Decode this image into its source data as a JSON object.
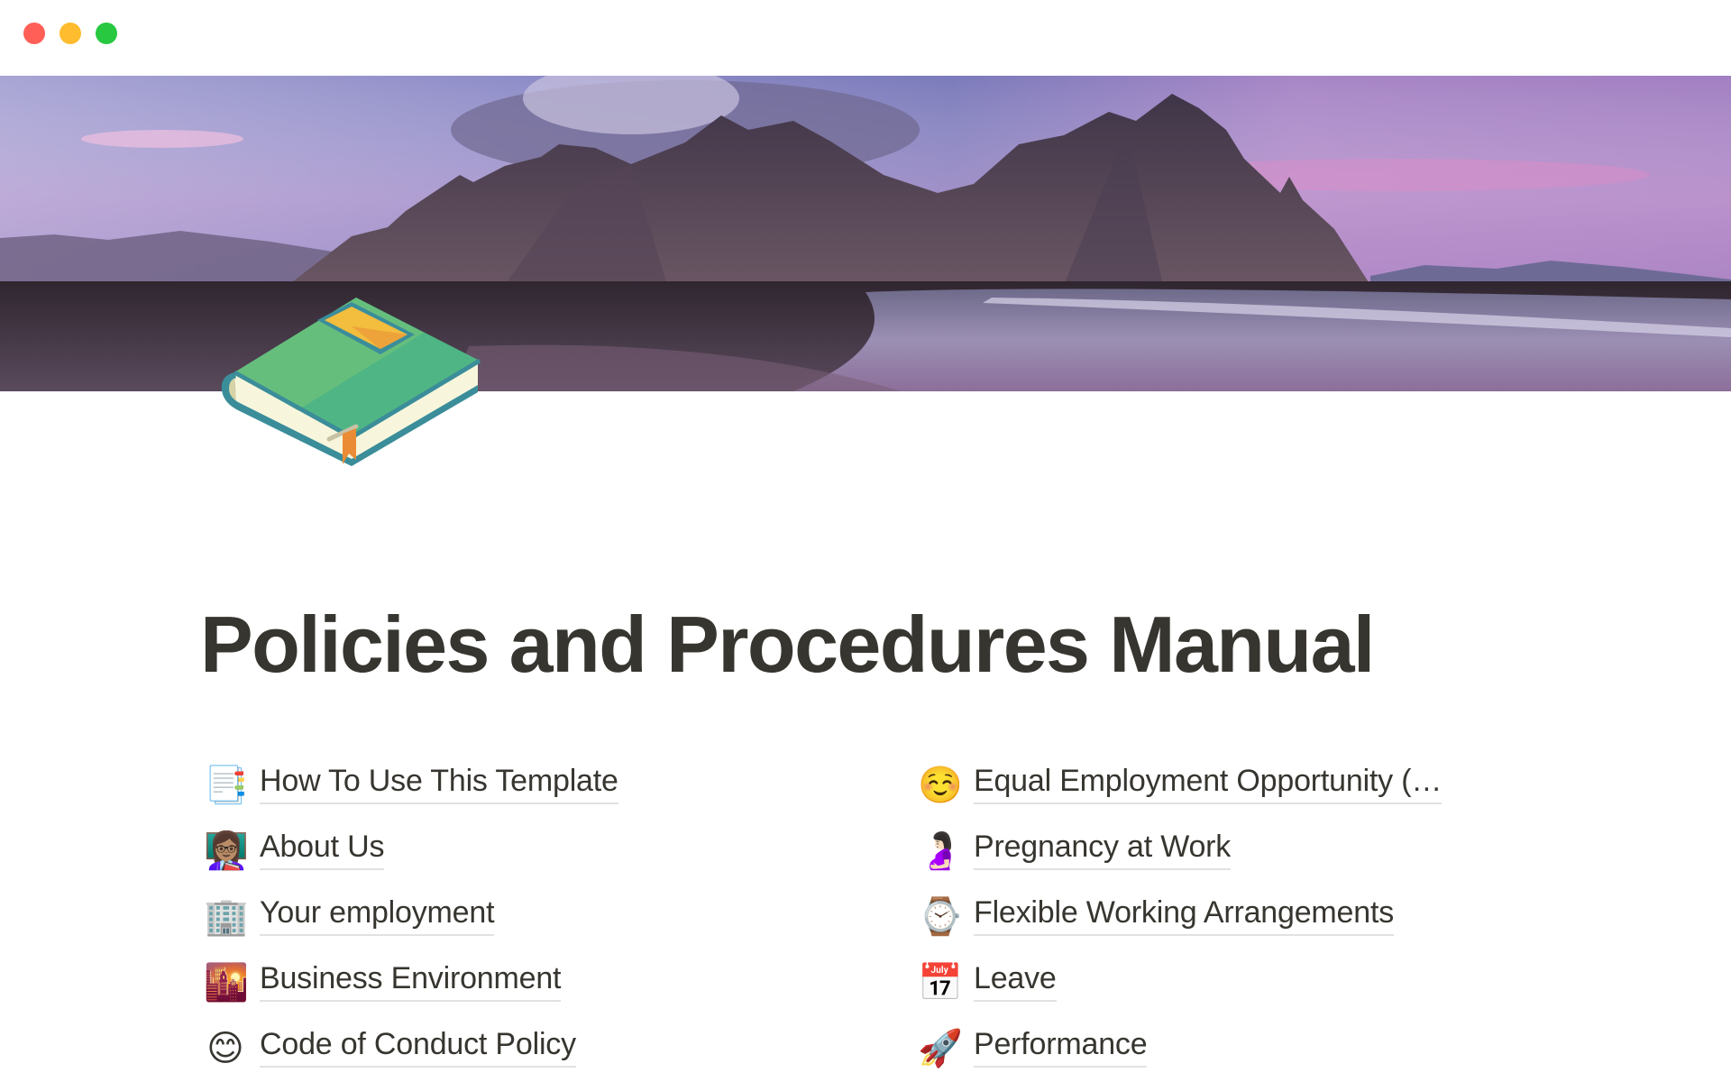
{
  "window": {
    "controls": [
      "close",
      "minimize",
      "maximize"
    ],
    "colors": {
      "close": "#ff5f57",
      "minimize": "#febc2e",
      "maximize": "#28c840"
    }
  },
  "cover": {
    "description": "mountain-beach-sunset-cover",
    "icon": "green-book-icon"
  },
  "page": {
    "title": "Policies and Procedures Manual"
  },
  "links": {
    "left": [
      {
        "icon": "📑",
        "icon_name": "bookmark-tabs-icon",
        "label": "How To Use This Template"
      },
      {
        "icon": "👩🏽‍🏫",
        "icon_name": "woman-teacher-icon",
        "label": "About Us"
      },
      {
        "icon": "🏢",
        "icon_name": "office-building-icon",
        "label": "Your employment"
      },
      {
        "icon": "🌇",
        "icon_name": "city-sunset-icon",
        "label": "Business Environment"
      },
      {
        "icon": "😊",
        "icon_name": "smiling-face-icon",
        "label": "Code of Conduct Policy"
      }
    ],
    "right": [
      {
        "icon": "☺️",
        "icon_name": "relaxed-face-icon",
        "label": "Equal Employment Opportunity (…"
      },
      {
        "icon": "🤰🏻",
        "icon_name": "pregnant-woman-icon",
        "label": "Pregnancy at Work"
      },
      {
        "icon": "⌚",
        "icon_name": "watch-icon",
        "label": "Flexible Working Arrangements"
      },
      {
        "icon": "📅",
        "icon_name": "calendar-icon",
        "label": "Leave"
      },
      {
        "icon": "🚀",
        "icon_name": "rocket-icon",
        "label": "Performance"
      }
    ]
  }
}
